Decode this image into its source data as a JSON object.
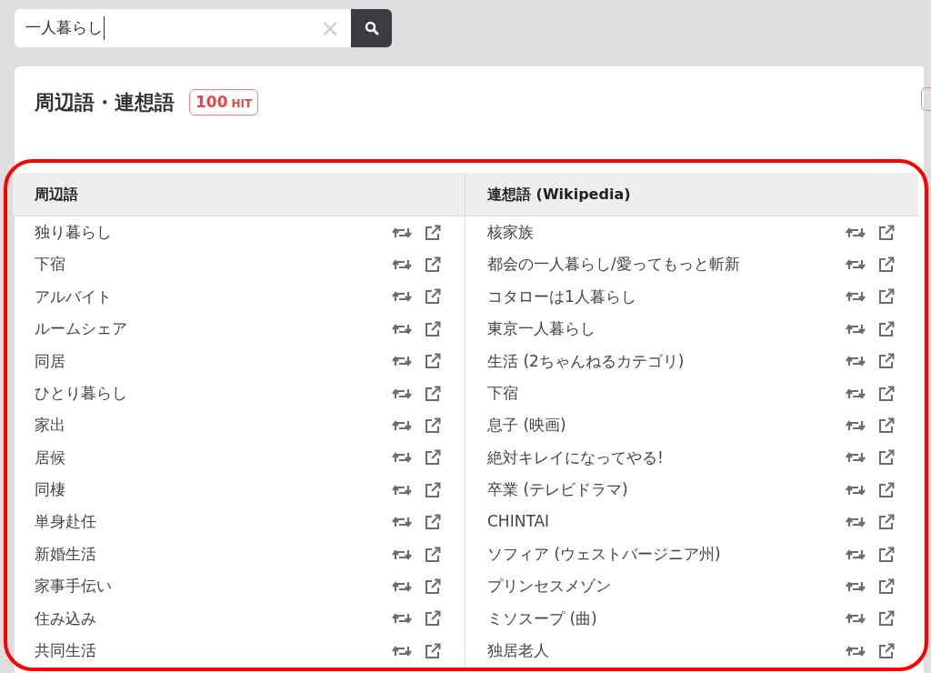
{
  "search": {
    "value": "一人暮らし",
    "clear": "×"
  },
  "section": {
    "title": "周辺語・連想語",
    "hit_count": "100",
    "hit_unit": "HIT"
  },
  "columns": [
    {
      "heading": "周辺語",
      "items": [
        "独り暮らし",
        "下宿",
        "アルバイト",
        "ルームシェア",
        "同居",
        "ひとり暮らし",
        "家出",
        "居候",
        "同棲",
        "単身赴任",
        "新婚生活",
        "家事手伝い",
        "住み込み",
        "共同生活"
      ]
    },
    {
      "heading": "連想語 (Wikipedia)",
      "items": [
        "核家族",
        "都会の一人暮らし/愛ってもっと斬新",
        "コタローは1人暮らし",
        "東京一人暮らし",
        "生活 (2ちゃんねるカテゴリ)",
        "下宿",
        "息子 (映画)",
        "絶対キレイになってやる!",
        "卒業 (テレビドラマ)",
        "CHINTAI",
        "ソフィア (ウェストバージニア州)",
        "プリンセスメゾン",
        "ミソスープ (曲)",
        "独居老人"
      ]
    }
  ]
}
